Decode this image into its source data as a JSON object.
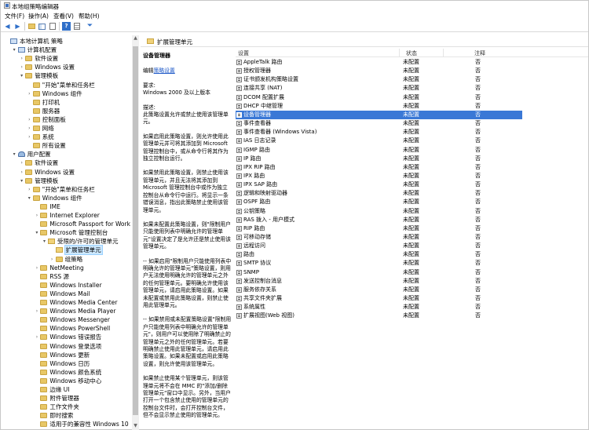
{
  "window": {
    "title": "本地组策略编辑器"
  },
  "menu": [
    "文件(F)",
    "操作(A)",
    "查看(V)",
    "帮助(H)"
  ],
  "toolbar": [
    "back-icon",
    "forward-icon",
    "up-folder-icon",
    "show-hide-tree-icon",
    "export-list-icon",
    "help-icon",
    "properties-icon",
    "filter-icon"
  ],
  "tree": [
    {
      "label": "本地计算机 策略",
      "depth": 0,
      "icon": "computer",
      "twisty": ""
    },
    {
      "label": "计算机配置",
      "depth": 1,
      "icon": "computer",
      "twisty": "▾"
    },
    {
      "label": "软件设置",
      "depth": 2,
      "icon": "folder",
      "twisty": "›"
    },
    {
      "label": "Windows 设置",
      "depth": 2,
      "icon": "folder",
      "twisty": "›"
    },
    {
      "label": "管理模板",
      "depth": 2,
      "icon": "folder",
      "twisty": "▾"
    },
    {
      "label": "\"开始\"菜单和任务栏",
      "depth": 3,
      "icon": "folder",
      "twisty": ""
    },
    {
      "label": "Windows 组件",
      "depth": 3,
      "icon": "folder",
      "twisty": "›"
    },
    {
      "label": "打印机",
      "depth": 3,
      "icon": "folder",
      "twisty": ""
    },
    {
      "label": "服务器",
      "depth": 3,
      "icon": "folder",
      "twisty": ""
    },
    {
      "label": "控制面板",
      "depth": 3,
      "icon": "folder",
      "twisty": "›"
    },
    {
      "label": "网络",
      "depth": 3,
      "icon": "folder",
      "twisty": "›"
    },
    {
      "label": "系统",
      "depth": 3,
      "icon": "folder",
      "twisty": "›"
    },
    {
      "label": "所有设置",
      "depth": 3,
      "icon": "folder",
      "twisty": ""
    },
    {
      "label": "用户配置",
      "depth": 1,
      "icon": "user",
      "twisty": "▾"
    },
    {
      "label": "软件设置",
      "depth": 2,
      "icon": "folder",
      "twisty": "›"
    },
    {
      "label": "Windows 设置",
      "depth": 2,
      "icon": "folder",
      "twisty": "›"
    },
    {
      "label": "管理模板",
      "depth": 2,
      "icon": "folder",
      "twisty": "▾"
    },
    {
      "label": "\"开始\"菜单和任务栏",
      "depth": 3,
      "icon": "folder",
      "twisty": "›"
    },
    {
      "label": "Windows 组件",
      "depth": 3,
      "icon": "folder",
      "twisty": "▾"
    },
    {
      "label": "IME",
      "depth": 4,
      "icon": "folder",
      "twisty": ""
    },
    {
      "label": "Internet Explorer",
      "depth": 4,
      "icon": "folder",
      "twisty": "›"
    },
    {
      "label": "Microsoft Passport for Work",
      "depth": 4,
      "icon": "folder",
      "twisty": ""
    },
    {
      "label": "Microsoft 管理控制台",
      "depth": 4,
      "icon": "folder",
      "twisty": "▾"
    },
    {
      "label": "受限的/许可的管理单元",
      "depth": 5,
      "icon": "folder-open",
      "twisty": "▾"
    },
    {
      "label": "扩展管理单元",
      "depth": 6,
      "icon": "folder-open",
      "twisty": "",
      "selected": true
    },
    {
      "label": "组策略",
      "depth": 6,
      "icon": "folder",
      "twisty": "›"
    },
    {
      "label": "NetMeeting",
      "depth": 4,
      "icon": "folder",
      "twisty": "›"
    },
    {
      "label": "RSS 源",
      "depth": 4,
      "icon": "folder",
      "twisty": ""
    },
    {
      "label": "Windows Installer",
      "depth": 4,
      "icon": "folder",
      "twisty": ""
    },
    {
      "label": "Windows Mail",
      "depth": 4,
      "icon": "folder",
      "twisty": ""
    },
    {
      "label": "Windows Media Center",
      "depth": 4,
      "icon": "folder",
      "twisty": ""
    },
    {
      "label": "Windows Media Player",
      "depth": 4,
      "icon": "folder",
      "twisty": "›"
    },
    {
      "label": "Windows Messenger",
      "depth": 4,
      "icon": "folder",
      "twisty": ""
    },
    {
      "label": "Windows PowerShell",
      "depth": 4,
      "icon": "folder",
      "twisty": ""
    },
    {
      "label": "Windows 错误报告",
      "depth": 4,
      "icon": "folder",
      "twisty": "›"
    },
    {
      "label": "Windows 登录选项",
      "depth": 4,
      "icon": "folder",
      "twisty": ""
    },
    {
      "label": "Windows 更新",
      "depth": 4,
      "icon": "folder",
      "twisty": ""
    },
    {
      "label": "Windows 日历",
      "depth": 4,
      "icon": "folder",
      "twisty": ""
    },
    {
      "label": "Windows 颜色系统",
      "depth": 4,
      "icon": "folder",
      "twisty": ""
    },
    {
      "label": "Windows 移动中心",
      "depth": 4,
      "icon": "folder",
      "twisty": ""
    },
    {
      "label": "边缘 UI",
      "depth": 4,
      "icon": "folder",
      "twisty": ""
    },
    {
      "label": "附件管理器",
      "depth": 4,
      "icon": "folder",
      "twisty": ""
    },
    {
      "label": "工作文件夹",
      "depth": 4,
      "icon": "folder",
      "twisty": ""
    },
    {
      "label": "即时搜索",
      "depth": 4,
      "icon": "folder",
      "twisty": ""
    },
    {
      "label": "适用于的兼容性 Windows 10",
      "depth": 4,
      "icon": "folder",
      "twisty": ""
    }
  ],
  "right_header": "扩展管理单元",
  "description": {
    "title": "设备管理器",
    "edit_prefix": "编辑",
    "edit_link": "策略设置",
    "requirements_label": "要求:",
    "requirements": "Windows 2000 及以上版本",
    "desc_label": "描述:",
    "paragraphs": [
      "此策略设置允许或禁止使用该管理单元。",
      "如果启用此策略设置，则允许使用此管理单元并可将其添加到 Microsoft 管理控制台中，或从命令行将其作为独立控制台运行。",
      "如果禁用此策略设置，则禁止使用该管理单元，并且无法将其添加到 Microsoft 管理控制台中或作为独立控制台从命令行中运行。将显示一条错误消息，指出此策略禁止使用该管理单元。",
      "如果未配置此策略设置，则\"限制用户只能使用列表中明确允许的管理单元\"设置决定了是允许还是禁止使用该管理单元。",
      "-- 如果启用\"限制用户只能使用列表中明确允许的管理单元\"策略设置，则用户无法使用明确允许的管理单元之外的任何管理单元。要明确允许使用该管理单元，请启用此策略设置。如果未配置或禁用此策略设置，则禁止使用此管理单元。",
      "-- 如果禁用或未配置策略设置\"限制用户只能使用列表中明确允许的管理单元\"，则用户可以使用除了明确禁止的管理单元之外的任何管理单元。若要明确禁止使用此管理单元，请启用此策略设置。如果未配置或启用此策略设置，则允许使用该管理单元。",
      "如果禁止使用某个管理单元，则该管理单元将不会在 MMC 的\"添加/删除管理单元\"窗口中显示。另外，当用户打开一个包含禁止使用的管理单元的控制台文件时，会打开控制台文件，但不会显示禁止使用的管理单元。"
    ]
  },
  "columns": {
    "setting": "设置",
    "state": "状态",
    "comment": "注释"
  },
  "settings": [
    {
      "name": "AppleTalk 路由",
      "state": "未配置",
      "comment": "否"
    },
    {
      "name": "授权管理器",
      "state": "未配置",
      "comment": "否"
    },
    {
      "name": "证书颁发机构策略设置",
      "state": "未配置",
      "comment": "否"
    },
    {
      "name": "连接共享 (NAT)",
      "state": "未配置",
      "comment": "否"
    },
    {
      "name": "DCOM 配置扩展",
      "state": "未配置",
      "comment": "否"
    },
    {
      "name": "DHCP 中继管理",
      "state": "未配置",
      "comment": "否"
    },
    {
      "name": "设备管理器",
      "state": "未配置",
      "comment": "否",
      "selected": true
    },
    {
      "name": "事件查看器",
      "state": "未配置",
      "comment": "否"
    },
    {
      "name": "事件查看器 (Windows Vista)",
      "state": "未配置",
      "comment": "否"
    },
    {
      "name": "IAS 日志记录",
      "state": "未配置",
      "comment": "否"
    },
    {
      "name": "IGMP 路由",
      "state": "未配置",
      "comment": "否"
    },
    {
      "name": "IP 路由",
      "state": "未配置",
      "comment": "否"
    },
    {
      "name": "IPX RIP 路由",
      "state": "未配置",
      "comment": "否"
    },
    {
      "name": "IPX 路由",
      "state": "未配置",
      "comment": "否"
    },
    {
      "name": "IPX SAP 路由",
      "state": "未配置",
      "comment": "否"
    },
    {
      "name": "逻辑和映射驱动器",
      "state": "未配置",
      "comment": "否"
    },
    {
      "name": "OSPF 路由",
      "state": "未配置",
      "comment": "否"
    },
    {
      "name": "公钥策略",
      "state": "未配置",
      "comment": "否"
    },
    {
      "name": "RAS 拨入 - 用户模式",
      "state": "未配置",
      "comment": "否"
    },
    {
      "name": "RIP 路由",
      "state": "未配置",
      "comment": "否"
    },
    {
      "name": "可移动存储",
      "state": "未配置",
      "comment": "否"
    },
    {
      "name": "远程访问",
      "state": "未配置",
      "comment": "否"
    },
    {
      "name": "路由",
      "state": "未配置",
      "comment": "否"
    },
    {
      "name": "SMTP 协议",
      "state": "未配置",
      "comment": "否"
    },
    {
      "name": "SNMP",
      "state": "未配置",
      "comment": "否"
    },
    {
      "name": "发送控制台消息",
      "state": "未配置",
      "comment": "否"
    },
    {
      "name": "服务依存关系",
      "state": "未配置",
      "comment": "否"
    },
    {
      "name": "共享文件夹扩展",
      "state": "未配置",
      "comment": "否"
    },
    {
      "name": "系统属性",
      "state": "未配置",
      "comment": "否"
    },
    {
      "name": "扩展视图(Web 视图)",
      "state": "未配置",
      "comment": "否"
    }
  ],
  "colors": {
    "selection": "#3a78d6",
    "tree_selection": "#cce8ff",
    "link": "#1a56c7",
    "folder": "#e8c766"
  }
}
